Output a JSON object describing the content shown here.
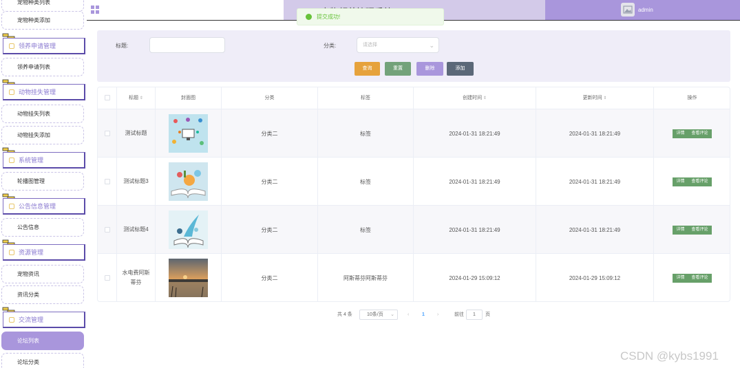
{
  "header": {
    "title": "宠物领养管理系统",
    "user": "admin"
  },
  "toast": "提交成功!",
  "sidebar": {
    "items": [
      {
        "type": "sub",
        "label": "宠物种类列表"
      },
      {
        "type": "sub",
        "label": "宠物种类添加"
      },
      {
        "type": "group",
        "label": "领养申请管理"
      },
      {
        "type": "sub",
        "label": "领养申请列表"
      },
      {
        "type": "group",
        "label": "动物挂失管理"
      },
      {
        "type": "sub",
        "label": "动物挂失列表"
      },
      {
        "type": "sub",
        "label": "动物挂失添加"
      },
      {
        "type": "group",
        "label": "系统管理"
      },
      {
        "type": "sub",
        "label": "轮播图管理"
      },
      {
        "type": "group",
        "label": "公告信息管理"
      },
      {
        "type": "sub",
        "label": "公告信息"
      },
      {
        "type": "group",
        "label": "资源管理"
      },
      {
        "type": "sub",
        "label": "宠物资讯"
      },
      {
        "type": "sub",
        "label": "资讯分类"
      },
      {
        "type": "group",
        "label": "交流管理"
      },
      {
        "type": "sub",
        "label": "论坛列表",
        "active": true
      },
      {
        "type": "sub",
        "label": "论坛分类"
      }
    ]
  },
  "search": {
    "title_label": "标题:",
    "title_value": "",
    "category_label": "分类:",
    "category_placeholder": "请选择",
    "buttons": [
      {
        "label": "查询",
        "color": "#e6a23c"
      },
      {
        "label": "重置",
        "color": "#73a27a"
      },
      {
        "label": "删除",
        "color": "#a996dc"
      },
      {
        "label": "添加",
        "color": "#5b6878"
      }
    ]
  },
  "table": {
    "columns": [
      "",
      "标题",
      "封面图",
      "分类",
      "标签",
      "创建时间",
      "更新时间",
      "操作"
    ],
    "rows": [
      {
        "title": "测试标题",
        "category": "分类二",
        "tag": "标签",
        "created": "2024-01-31 18:21:49",
        "updated": "2024-01-31 18:21:49",
        "cover": "network-illustration"
      },
      {
        "title": "测试标题3",
        "category": "分类二",
        "tag": "标签",
        "created": "2024-01-31 18:21:49",
        "updated": "2024-01-31 18:21:49",
        "cover": "book-illustration"
      },
      {
        "title": "测试标题4",
        "category": "分类二",
        "tag": "标签",
        "created": "2024-01-31 18:21:49",
        "updated": "2024-01-31 18:21:49",
        "cover": "book-splash-illustration"
      },
      {
        "title": "水电费阿斯蒂芬",
        "category": "分类二",
        "tag": "阿斯蒂芬阿斯蒂芬",
        "created": "2024-01-29 15:09:12",
        "updated": "2024-01-29 15:09:12",
        "cover": "sunset-lake-photo"
      }
    ],
    "actions": {
      "detail": "详情",
      "comments": "查看评论"
    }
  },
  "pagination": {
    "total": "共 4 条",
    "page_size": "10条/页",
    "prev": "‹",
    "current": "1",
    "next": "›",
    "goto_prefix": "前往",
    "goto_value": "1",
    "goto_suffix": "页"
  },
  "watermark": "CSDN @kybs1991"
}
